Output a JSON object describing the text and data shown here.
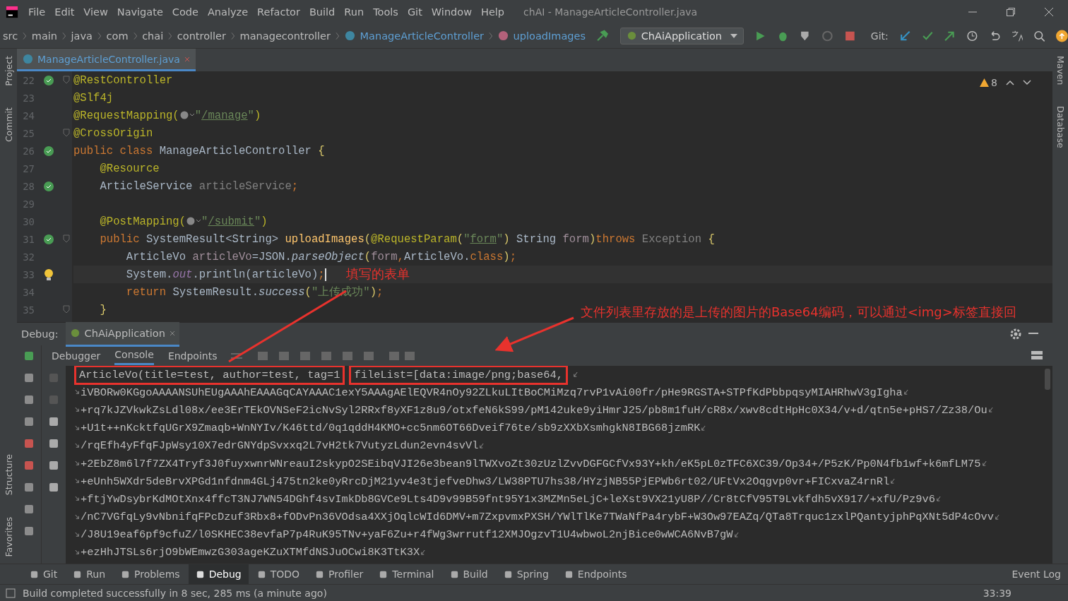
{
  "menu": [
    "File",
    "Edit",
    "View",
    "Navigate",
    "Code",
    "Analyze",
    "Refactor",
    "Build",
    "Run",
    "Tools",
    "Git",
    "Window",
    "Help"
  ],
  "window_title": "chAI - ManageArticleController.java",
  "breadcrumbs": [
    {
      "label": "src",
      "kind": "folder"
    },
    {
      "label": "main",
      "kind": "folder"
    },
    {
      "label": "java",
      "kind": "folder"
    },
    {
      "label": "com",
      "kind": "folder"
    },
    {
      "label": "chai",
      "kind": "folder"
    },
    {
      "label": "controller",
      "kind": "folder"
    },
    {
      "label": "managecontroller",
      "kind": "folder"
    },
    {
      "label": "ManageArticleController",
      "kind": "class"
    },
    {
      "label": "uploadImages",
      "kind": "method"
    }
  ],
  "run_config": "ChAiApplication",
  "git_label": "Git:",
  "editor_tab": {
    "label": "ManageArticleController.java",
    "selected": true
  },
  "left_tools": [
    "Project",
    "Commit",
    "Structure",
    "Favorites"
  ],
  "right_tools": [
    "Maven",
    "Database"
  ],
  "warning_count": "8",
  "code_lines": [
    {
      "number": "22",
      "kind": "bean",
      "fold": true,
      "current": false,
      "tokens": [
        {
          "kind": "ann",
          "text": "@RestController"
        }
      ]
    },
    {
      "number": "23",
      "kind": "none",
      "fold": false,
      "current": false,
      "tokens": [
        {
          "kind": "ann",
          "text": "@Slf4j"
        }
      ]
    },
    {
      "number": "24",
      "kind": "none",
      "fold": false,
      "current": false,
      "tokens": [
        {
          "kind": "ann",
          "text": "@RequestMapping("
        },
        {
          "kind": "globe"
        },
        {
          "kind": "str",
          "text": "\""
        },
        {
          "kind": "url",
          "text": "/manage"
        },
        {
          "kind": "str",
          "text": "\""
        },
        {
          "kind": "ann",
          "text": ")"
        }
      ]
    },
    {
      "number": "25",
      "kind": "none",
      "fold": true,
      "current": false,
      "tokens": [
        {
          "kind": "ann",
          "text": "@CrossOrigin"
        }
      ]
    },
    {
      "number": "26",
      "kind": "bean",
      "fold": false,
      "current": false,
      "tokens": [
        {
          "kind": "kw",
          "text": "public class "
        },
        {
          "kind": "plain",
          "text": "ManageArticleController "
        },
        {
          "kind": "brace",
          "text": "{"
        }
      ]
    },
    {
      "number": "27",
      "kind": "none",
      "fold": false,
      "current": false,
      "tokens": [
        {
          "kind": "ann",
          "text": "    @Resource"
        }
      ]
    },
    {
      "number": "28",
      "kind": "bean",
      "fold": false,
      "current": false,
      "tokens": [
        {
          "kind": "plain",
          "text": "    ArticleService "
        },
        {
          "kind": "unused",
          "text": "articleService"
        },
        {
          "kind": "kw",
          "text": ";"
        }
      ]
    },
    {
      "number": "29",
      "kind": "none",
      "fold": false,
      "current": false
    },
    {
      "number": "30",
      "kind": "none",
      "fold": false,
      "current": false,
      "tokens": [
        {
          "kind": "ann",
          "text": "    @PostMapping("
        },
        {
          "kind": "globe"
        },
        {
          "kind": "str",
          "text": "\""
        },
        {
          "kind": "url",
          "text": "/submit"
        },
        {
          "kind": "str",
          "text": "\""
        },
        {
          "kind": "ann",
          "text": ")"
        }
      ]
    },
    {
      "number": "31",
      "kind": "bean",
      "fold": true,
      "current": false,
      "tokens": [
        {
          "kind": "kw",
          "text": "    public "
        },
        {
          "kind": "plain",
          "text": "SystemResult<String> "
        },
        {
          "kind": "method",
          "text": "uploadImages"
        },
        {
          "kind": "brace",
          "text": "("
        },
        {
          "kind": "ann",
          "text": "@RequestParam"
        },
        {
          "kind": "brace",
          "text": "("
        },
        {
          "kind": "str",
          "text": "\""
        },
        {
          "kind": "url",
          "text": "form"
        },
        {
          "kind": "str",
          "text": "\""
        },
        {
          "kind": "brace",
          "text": ")"
        },
        {
          "kind": "plain",
          "text": " String "
        },
        {
          "kind": "param",
          "text": "form"
        },
        {
          "kind": "brace",
          "text": ")"
        },
        {
          "kind": "kw",
          "text": "throws "
        },
        {
          "kind": "unused",
          "text": "Exception"
        },
        {
          "kind": "brace",
          "text": " {"
        }
      ]
    },
    {
      "number": "32",
      "kind": "none",
      "fold": false,
      "current": false,
      "tokens": [
        {
          "kind": "plain",
          "text": "        ArticleVo "
        },
        {
          "kind": "param",
          "text": "articleVo"
        },
        {
          "kind": "plain",
          "text": "=JSON."
        },
        {
          "kind": "italic",
          "text": "parseObject"
        },
        {
          "kind": "brace",
          "text": "("
        },
        {
          "kind": "param",
          "text": "form"
        },
        {
          "kind": "kw",
          "text": ","
        },
        {
          "kind": "plain",
          "text": "ArticleVo."
        },
        {
          "kind": "kw",
          "text": "class"
        },
        {
          "kind": "brace",
          "text": ")"
        },
        {
          "kind": "kw",
          "text": ";"
        }
      ]
    },
    {
      "number": "33",
      "kind": "bulb",
      "fold": false,
      "current": true,
      "tokens": [
        {
          "kind": "plain",
          "text": "        System."
        },
        {
          "kind": "field",
          "text": "out"
        },
        {
          "kind": "plain",
          "text": ".println(articleVo)"
        },
        {
          "kind": "kw",
          "text": ";"
        }
      ]
    },
    {
      "number": "34",
      "kind": "none",
      "fold": false,
      "current": false,
      "tokens": [
        {
          "kind": "kw",
          "text": "        return "
        },
        {
          "kind": "plain",
          "text": "SystemResult."
        },
        {
          "kind": "italic",
          "text": "success"
        },
        {
          "kind": "brace",
          "text": "("
        },
        {
          "kind": "str",
          "text": "\"上传成功\""
        },
        {
          "kind": "brace",
          "text": ")"
        },
        {
          "kind": "kw",
          "text": ";"
        }
      ]
    },
    {
      "number": "35",
      "kind": "none",
      "fold": true,
      "current": false,
      "tokens": [
        {
          "kind": "brace",
          "text": "    }"
        }
      ]
    }
  ],
  "debug": {
    "label": "Debug:",
    "session": "ChAiApplication",
    "tabs": [
      {
        "label": "Debugger",
        "selected": false
      },
      {
        "label": "Console",
        "selected": true
      },
      {
        "label": "Endpoints",
        "selected": false
      }
    ],
    "output": [
      {
        "continued": false,
        "wraps": true,
        "segments": [
          {
            "text": "ArticleVo(title=test, author=test, tag=1",
            "boxed": true
          },
          {
            "text": "fileList=[data:image/png;base64,",
            "boxed": true
          }
        ]
      },
      {
        "continued": true,
        "wraps": true,
        "segments": [
          {
            "text": "iVBORw0KGgoAAAANSUhEUgAAAhEAAAGqCAYAAAC1exY5AAAgAElEQVR4nOy92ZLkuLItBoCMiMzq7rvP1vAi00fr/pHe9RGSTA+STPfKdPbbpqsyMIAHRhwV3gIgha",
            "boxed": false
          }
        ]
      },
      {
        "continued": true,
        "wraps": true,
        "segments": [
          {
            "text": "+rq7kJZVkwkZsLdl08x/ee3ErTEkOVNSeF2icNvSyl2RRxf8yXF1z8u9/otxfeN6kS99/pM142uke9yiHmrJ25/pb8m1fuH/cR8x/xwv8cdtHpHc0X34/v+d/qtn5e+pHS7/Zz38/Ou",
            "boxed": false
          }
        ]
      },
      {
        "continued": true,
        "wraps": true,
        "segments": [
          {
            "text": "+U1t++nKcktfqUGrX9Zmaqb+WnNYIv/K46ttd/0q1qddH4KMO+cc5nm6OT66Dveif76te/sb9zXXbXsmhgkN8IBG68jzmRK",
            "boxed": false
          }
        ]
      },
      {
        "continued": true,
        "wraps": true,
        "segments": [
          {
            "text": "/rqEfh4yFfqFJpWsy10X7edrGNYdpSvxxq2L7vH2tk7VutyzLdun2evn4svVl",
            "boxed": false
          }
        ]
      },
      {
        "continued": true,
        "wraps": true,
        "segments": [
          {
            "text": "+2EbZ8m6l7f7ZX4Tryf3J0fuyxwnrWNreauI2skypO2SEibqVJI26e3bean9lTWXvoZt30zUzlZvvDGFGCfVx93Y+kh/eK5pL0zTFC6XC39/Op34+/P5zK/Pp0N4fb1wf+k6mfLM75",
            "boxed": false
          }
        ]
      },
      {
        "continued": true,
        "wraps": true,
        "segments": [
          {
            "text": "+eUnh5WXdr5deBrvXPGd1nfdnm4GLj475tn2ke0yRrcDjM21yv4e3tjefveDhw3/LW38PTU7hs38/HYzjNB55PjEPWb6rt02/UFtVx2Oqgvp0vr+FICxvaZ4rnRl",
            "boxed": false
          }
        ]
      },
      {
        "continued": true,
        "wraps": true,
        "segments": [
          {
            "text": "+ftjYwDsybrKdMOtXnx4ffcT3NJ7WN54DGhf4svImkDb8GVCe9Lts4D9v99B59fnt95Y1x3MZMn5eLjC+leXst9VX21yU8P//Cr8tCfV95T9Lvkfdh5vX917/+xfU/Pz9v6",
            "boxed": false
          }
        ]
      },
      {
        "continued": true,
        "wraps": true,
        "segments": [
          {
            "text": "/nC7VGfqLy9vNbnifqFPcDzuf3Rbx8+fODvPn36VOdsa4XXjOqlcWId6DMV+m7ZxpvmxPXSH/YWlTlKe7TWaNfPa4rybF+W3Ow97EAZq/QTa8Trquc1zxlPQantyjphPqXNt5dP4cOvv",
            "boxed": false
          }
        ]
      },
      {
        "continued": true,
        "wraps": true,
        "segments": [
          {
            "text": "/J8U19eaf6pf9cfuZ/l0SKHEC38evfaP7p4RuK95TNv+yaF6Zu+r4fWg3wrrutf12XMJOgzvT1U4wbwoL2njBice0wWCA6NvB7gW",
            "boxed": false
          }
        ]
      },
      {
        "continued": true,
        "wraps": true,
        "segments": [
          {
            "text": "+ezHhJTSLs6rjO9bWEmwzG303ageKZuXTMfdNSJuOCwi8K3TtK3X",
            "boxed": false
          }
        ]
      }
    ]
  },
  "bottom_tabs": [
    {
      "label": "Git",
      "selected": false
    },
    {
      "label": "Run",
      "selected": false
    },
    {
      "label": "Problems",
      "selected": false
    },
    {
      "label": "Debug",
      "selected": true
    },
    {
      "label": "TODO",
      "selected": false
    },
    {
      "label": "Profiler",
      "selected": false
    },
    {
      "label": "Terminal",
      "selected": false
    },
    {
      "label": "Build",
      "selected": false
    },
    {
      "label": "Spring",
      "selected": false
    },
    {
      "label": "Endpoints",
      "selected": false
    }
  ],
  "event_log": "Event Log",
  "status": {
    "message": "Build completed successfully in 8 sec, 285 ms (a minute ago)",
    "position": "33:39"
  },
  "annotations": [
    {
      "kind": "note",
      "text": "填写的表单"
    },
    {
      "kind": "note",
      "text": "文件列表里存放的是上传的图片的Base64编码，可以通过<img>标签直接回"
    }
  ]
}
